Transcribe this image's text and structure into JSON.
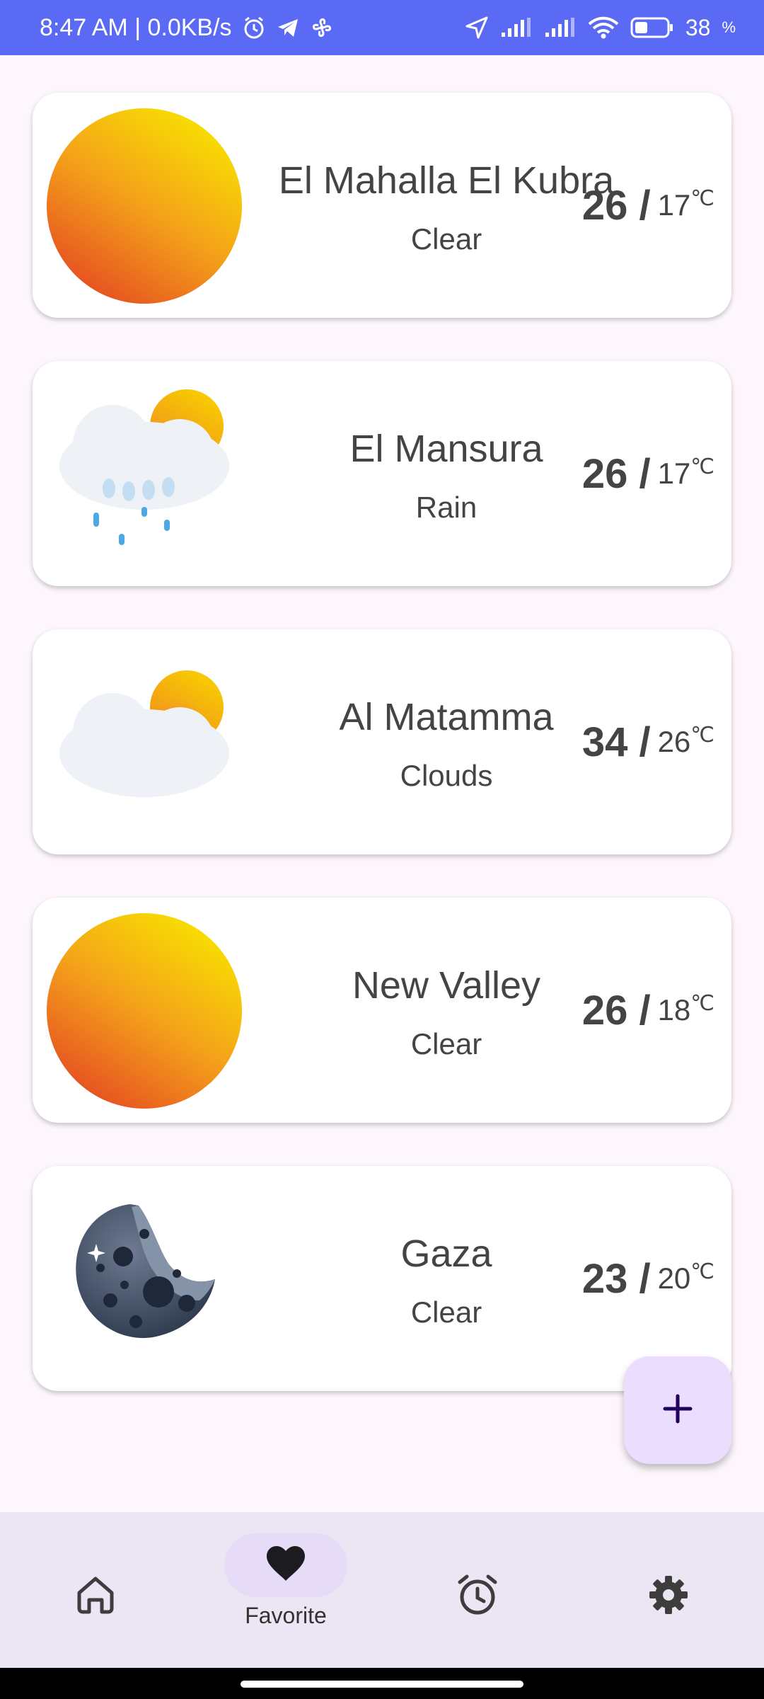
{
  "status_bar": {
    "time_speed": "8:47 AM | 0.0KB/s",
    "battery": "38"
  },
  "cities": [
    {
      "name": "El Mahalla El Kubra",
      "condition": "Clear",
      "high": "26 /",
      "low": "17",
      "unit": "℃",
      "icon": "sun-icon"
    },
    {
      "name": "El Mansura",
      "condition": "Rain",
      "high": "26 /",
      "low": "17",
      "unit": "℃",
      "icon": "rain-cloud-icon"
    },
    {
      "name": "Al Matamma",
      "condition": "Clouds",
      "high": "34 /",
      "low": "26",
      "unit": "℃",
      "icon": "cloud-sun-icon"
    },
    {
      "name": "New Valley",
      "condition": "Clear",
      "high": "26 /",
      "low": "18",
      "unit": "℃",
      "icon": "sun-icon"
    },
    {
      "name": "Gaza",
      "condition": "Clear",
      "high": "23 /",
      "low": "20",
      "unit": "℃",
      "icon": "moon-icon"
    }
  ],
  "fab": {
    "label": "+"
  },
  "nav": {
    "home": {
      "icon": "home-icon"
    },
    "favorite": {
      "label": "Favorite",
      "icon": "heart-icon"
    },
    "alarm": {
      "icon": "alarm-icon"
    },
    "settings": {
      "icon": "gear-icon"
    }
  },
  "colors": {
    "status_bar": "#5a6af5",
    "background": "#fdf7fd",
    "fab": "#ebddfd",
    "nav_bar": "#ece5f3",
    "nav_active_pill": "#e6dcf8"
  }
}
